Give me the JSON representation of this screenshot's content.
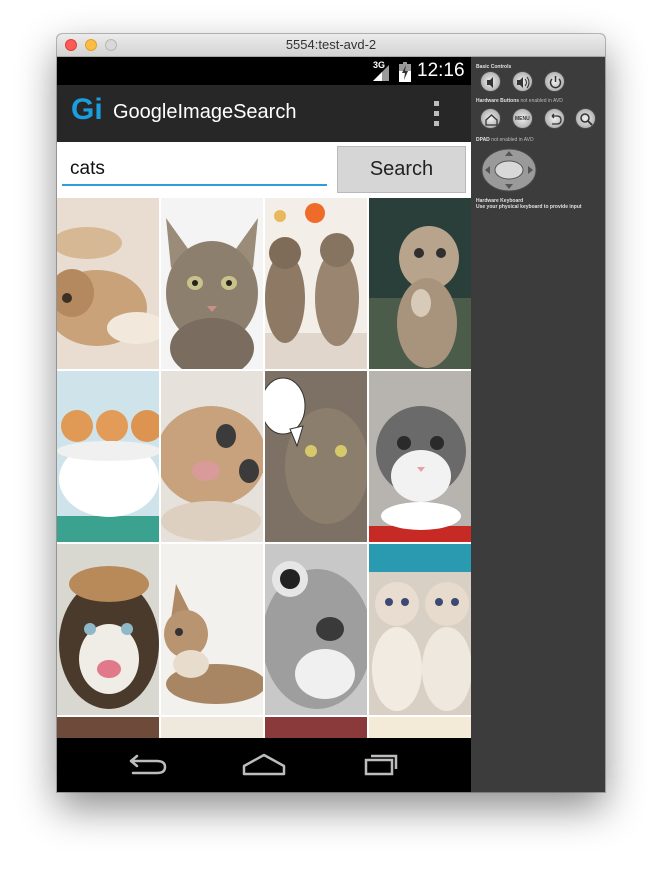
{
  "window": {
    "title": "5554:test-avd-2"
  },
  "status_bar": {
    "network": "3G",
    "time": "12:16"
  },
  "app": {
    "logo": "Gi",
    "title": "GoogleImageSearch"
  },
  "search": {
    "query": "cats",
    "button_label": "Search"
  },
  "results": {
    "tiles": [
      {
        "subject": "kitten-on-back"
      },
      {
        "subject": "tabby-cat-face"
      },
      {
        "subject": "three-kittens"
      },
      {
        "subject": "begging-kitten"
      },
      {
        "subject": "kittens-in-teacup"
      },
      {
        "subject": "lying-kitten-closeup"
      },
      {
        "subject": "tabby-with-speech-bubble"
      },
      {
        "subject": "grey-white-kitten"
      },
      {
        "subject": "hissing-kitten"
      },
      {
        "subject": "tabby-kitten-lying"
      },
      {
        "subject": "black-white-cat-face"
      },
      {
        "subject": "two-siamese-kittens"
      }
    ]
  },
  "nav": {
    "back": "back-icon",
    "home": "home-icon",
    "recents": "recents-icon"
  },
  "controls": {
    "basic_label": "Basic Controls",
    "hw_label": "Hardware Buttons",
    "hw_note": "not enabled in AVD",
    "dpad_label": "DPAD",
    "dpad_note": "not enabled in AVD",
    "keyboard_label": "Hardware Keyboard",
    "keyboard_note": "Use your physical keyboard to provide input",
    "menu_label": "MENU"
  },
  "colors": {
    "accent": "#2d9fd6",
    "logo": "#1b9ee0",
    "actionbar": "#272727"
  }
}
